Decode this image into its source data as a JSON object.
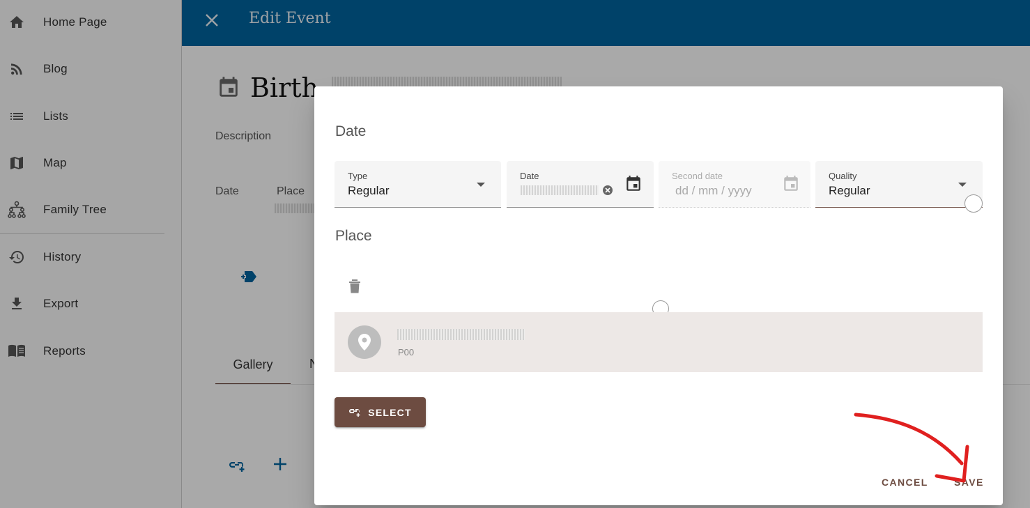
{
  "sidebar": {
    "items": [
      {
        "label": "Home Page",
        "icon": "home-icon"
      },
      {
        "label": "Blog",
        "icon": "rss-icon"
      },
      {
        "label": "Lists",
        "icon": "list-icon"
      },
      {
        "label": "Map",
        "icon": "map-icon"
      },
      {
        "label": "Family Tree",
        "icon": "family-tree-icon"
      },
      {
        "label": "History",
        "icon": "history-icon"
      },
      {
        "label": "Export",
        "icon": "download-icon"
      },
      {
        "label": "Reports",
        "icon": "book-icon"
      }
    ]
  },
  "header": {
    "title": "Edit Event",
    "close_icon": "close-icon",
    "background": "#00629b"
  },
  "main": {
    "event_title": "Birth",
    "description_label": "Description",
    "date_label": "Date",
    "place_label": "Place",
    "tabs": [
      {
        "label": "Gallery"
      },
      {
        "label": "N"
      }
    ]
  },
  "dialog": {
    "date_section_title": "Date",
    "type_field": {
      "label": "Type",
      "value": "Regular"
    },
    "date_field": {
      "label": "Date"
    },
    "second_date_field": {
      "label": "Second date",
      "placeholder": "dd / mm / yyyy"
    },
    "quality_field": {
      "label": "Quality",
      "value": "Regular"
    },
    "place_section_title": "Place",
    "place_card": {
      "id": "P00"
    },
    "select_button": "SELECT",
    "cancel_button": "CANCEL",
    "save_button": "SAVE"
  },
  "colors": {
    "accent": "#6d4c41",
    "header": "#00629b",
    "annotation": "#e0201f"
  }
}
